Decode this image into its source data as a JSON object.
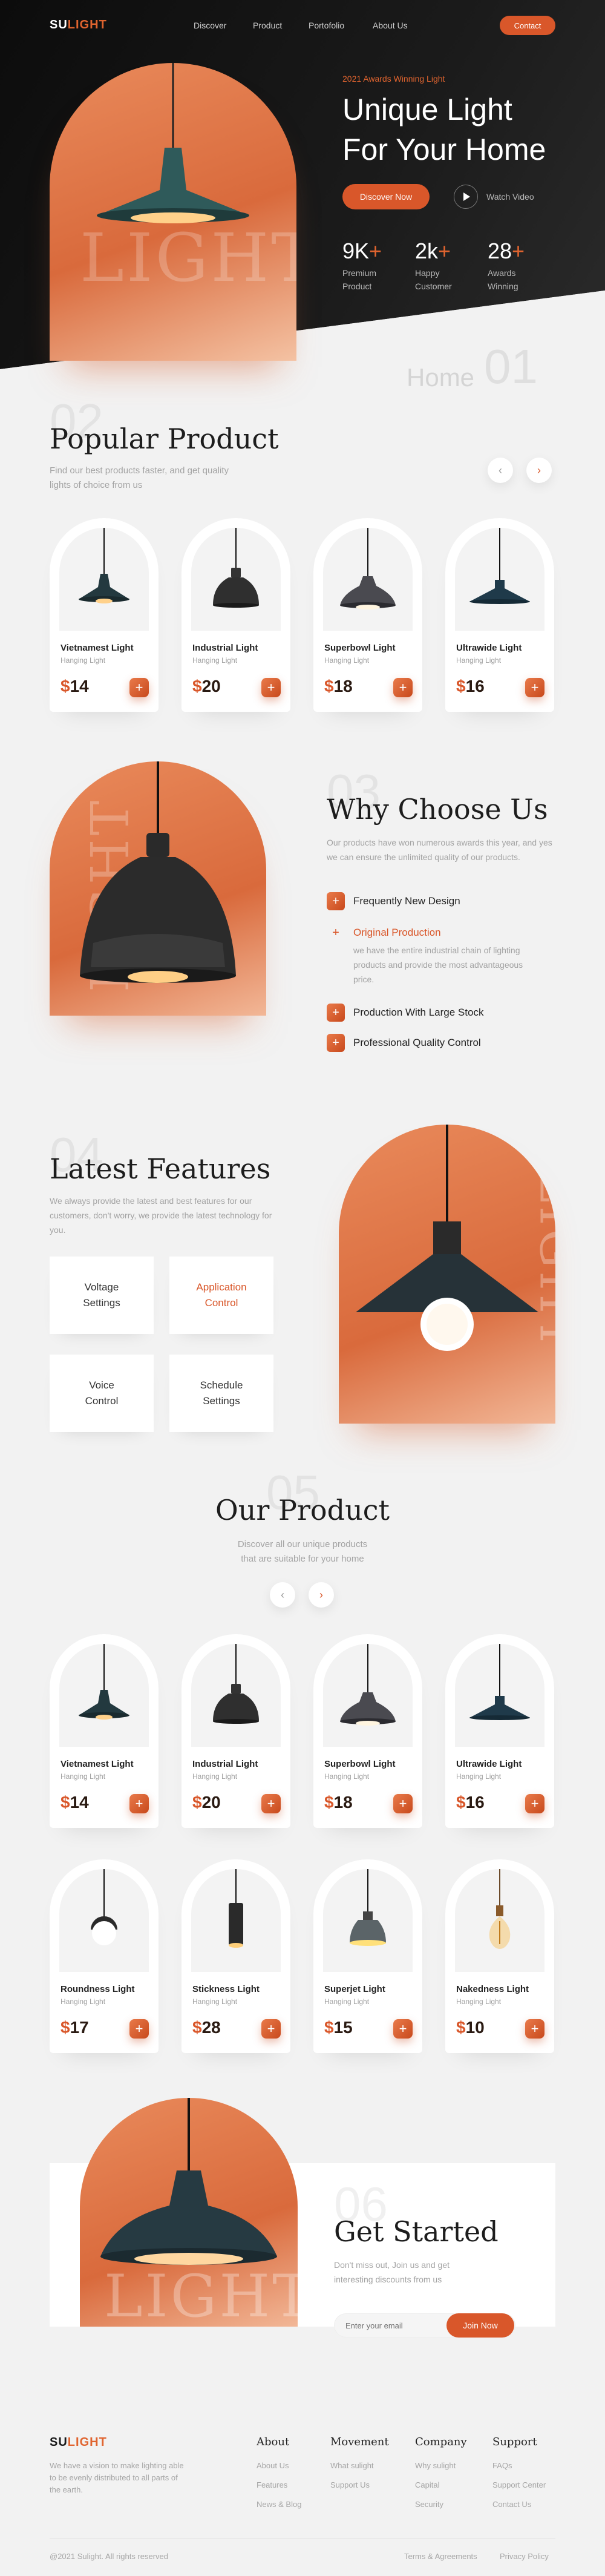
{
  "header": {
    "logo_su": "SU",
    "logo_light": "LIGHT",
    "nav": [
      "Discover",
      "Product",
      "Portofolio",
      "About Us"
    ],
    "contact": "Contact"
  },
  "hero": {
    "award": "2021 Awards Winning Light",
    "title_line1": "Unique Light",
    "title_line2": "For Your Home",
    "cta": "Discover Now",
    "watch": "Watch Video",
    "arch_word": "LIGHT",
    "stats": [
      {
        "value": "9K",
        "label": "Premium Product"
      },
      {
        "value": "2k",
        "label": "Happy Customer"
      },
      {
        "value": "28",
        "label": "Awards Winning"
      }
    ],
    "plus": "+",
    "home_label": "Home",
    "home_num": "01"
  },
  "popular": {
    "ghost": "02",
    "title": "Popular Product",
    "desc": "Find our best products faster, and get quality lights of choice from us",
    "prev": "‹",
    "next": "›",
    "products": [
      {
        "name": "Vietnamest Light",
        "sub": "Hanging Light",
        "price": "14"
      },
      {
        "name": "Industrial Light",
        "sub": "Hanging Light",
        "price": "20"
      },
      {
        "name": "Superbowl Light",
        "sub": "Hanging Light",
        "price": "18"
      },
      {
        "name": "Ultrawide Light",
        "sub": "Hanging Light",
        "price": "16"
      }
    ]
  },
  "why": {
    "ghost": "03",
    "title": "Why Choose Us",
    "desc": "Our products have won numerous awards this year, and yes we can ensure the unlimited quality of our products.",
    "arch_word": "LIGHT",
    "items": [
      {
        "label": "Frequently New Design"
      },
      {
        "label": "Original Production",
        "detail": "we have the entire industrial chain of lighting products and provide the most advantageous price."
      },
      {
        "label": "Production With Large Stock"
      },
      {
        "label": "Professional Quality Control"
      }
    ]
  },
  "features": {
    "ghost": "04",
    "title": "Latest Features",
    "desc": "We always provide the latest and best features for our customers, don't worry, we provide the latest technology for you.",
    "arch_word": "LIGHT",
    "boxes": [
      {
        "line1": "Voltage",
        "line2": "Settings"
      },
      {
        "line1": "Application",
        "line2": "Control"
      },
      {
        "line1": "Voice",
        "line2": "Control"
      },
      {
        "line1": "Schedule",
        "line2": "Settings"
      }
    ]
  },
  "our_product": {
    "ghost": "05",
    "title": "Our Product",
    "desc_line1": "Discover all our unique products",
    "desc_line2": "that are suitable for your home",
    "prev": "‹",
    "next": "›",
    "row1": [
      {
        "name": "Vietnamest Light",
        "sub": "Hanging Light",
        "price": "14"
      },
      {
        "name": "Industrial Light",
        "sub": "Hanging Light",
        "price": "20"
      },
      {
        "name": "Superbowl Light",
        "sub": "Hanging Light",
        "price": "18"
      },
      {
        "name": "Ultrawide Light",
        "sub": "Hanging Light",
        "price": "16"
      }
    ],
    "row2": [
      {
        "name": "Roundness Light",
        "sub": "Hanging Light",
        "price": "17"
      },
      {
        "name": "Stickness Light",
        "sub": "Hanging Light",
        "price": "28"
      },
      {
        "name": "Superjet Light",
        "sub": "Hanging Light",
        "price": "15"
      },
      {
        "name": "Nakedness Light",
        "sub": "Hanging Light",
        "price": "10"
      }
    ]
  },
  "get_started": {
    "ghost": "06",
    "title": "Get Started",
    "desc": "Don't miss out, Join us and get interesting discounts from us",
    "arch_word": "LIGHT",
    "placeholder": "Enter your email",
    "button": "Join Now"
  },
  "footer": {
    "logo_su": "SU",
    "logo_light": "LIGHT",
    "desc": "We have a vision to make lighting able to be evenly distributed to all parts of the earth.",
    "columns": [
      {
        "title": "About",
        "links": [
          "About Us",
          "Features",
          "News & Blog"
        ]
      },
      {
        "title": "Movement",
        "links": [
          "What sulight",
          "Support Us"
        ]
      },
      {
        "title": "Company",
        "links": [
          "Why sulight",
          "Capital",
          "Security"
        ]
      },
      {
        "title": "Support",
        "links": [
          "FAQs",
          "Support Center",
          "Contact Us"
        ]
      }
    ],
    "copyright": "@2021 Sulight. All rights reserved",
    "terms": "Terms & Agreements",
    "privacy": "Privacy Policy"
  },
  "colors": {
    "accent": "#d9572a",
    "dark": "#141414",
    "bg": "#f2f2f2"
  },
  "currency": "$"
}
